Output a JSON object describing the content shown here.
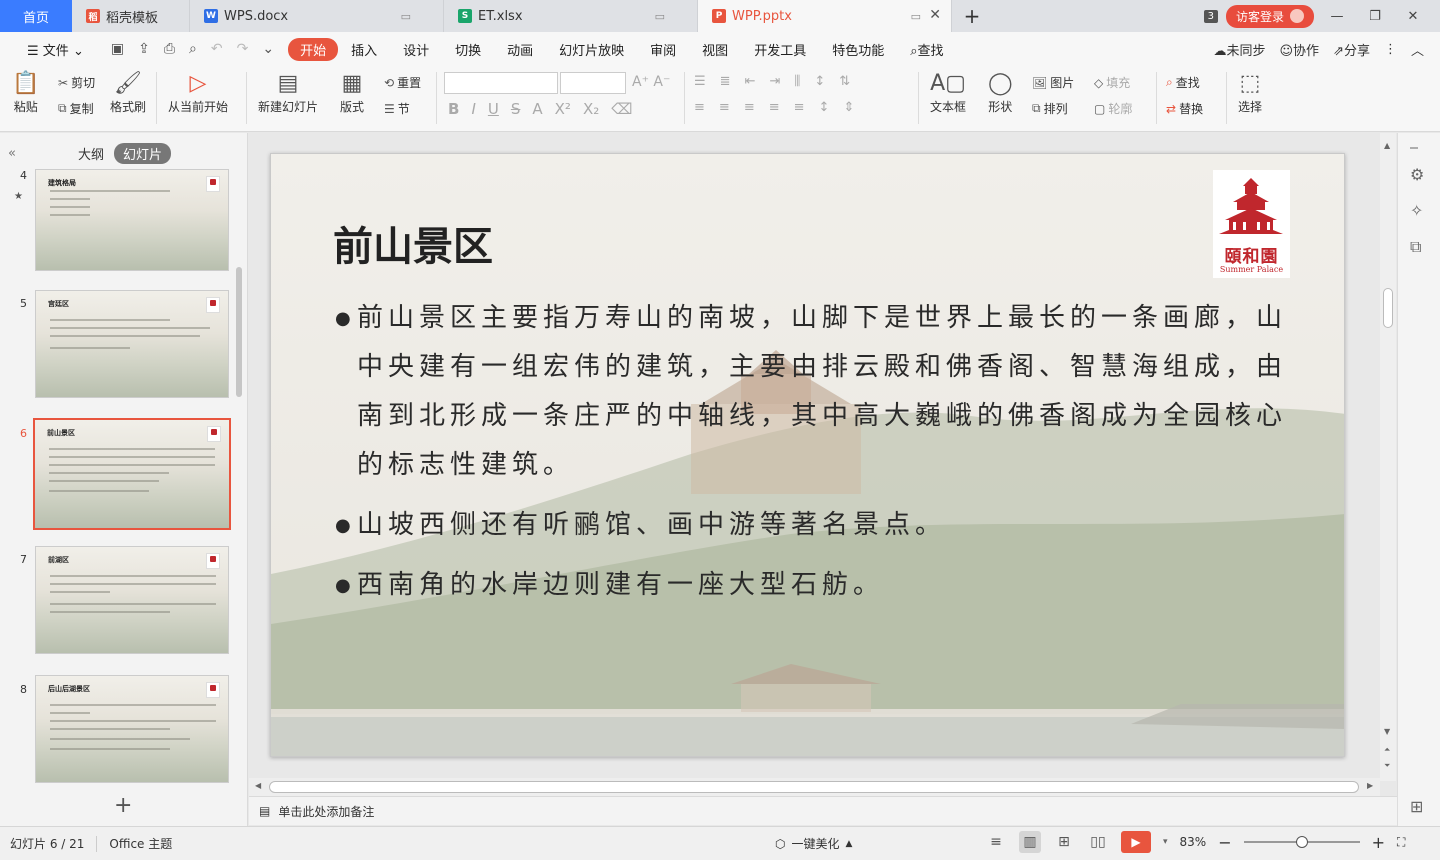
{
  "tabs": {
    "home": "首页",
    "items": [
      {
        "label": "稻壳模板",
        "icon": "daoke-icon",
        "color": "#e8553e"
      },
      {
        "label": "WPS.docx",
        "icon": "wps-writer-icon",
        "color": "#2f6ee5"
      },
      {
        "label": "ET.xlsx",
        "icon": "wps-sheet-icon",
        "color": "#1aa56b"
      },
      {
        "label": "WPP.pptx",
        "icon": "wps-ppt-icon",
        "color": "#e8553e"
      }
    ],
    "count": "3",
    "login": "访客登录"
  },
  "menu": {
    "file": "文件",
    "items": [
      "开始",
      "插入",
      "设计",
      "切换",
      "动画",
      "幻灯片放映",
      "审阅",
      "视图",
      "开发工具",
      "特色功能"
    ],
    "active": "开始",
    "search": "查找",
    "sync": "未同步",
    "collab": "协作",
    "share": "分享"
  },
  "ribbon": {
    "paste": "粘贴",
    "cut": "剪切",
    "copy": "复制",
    "format_painter": "格式刷",
    "from_current": "从当前开始",
    "new_slide": "新建幻灯片",
    "layout": "版式",
    "reset": "重置",
    "section": "节",
    "textbox": "文本框",
    "shape": "形状",
    "arrange": "排列",
    "picture": "图片",
    "fill": "填充",
    "outline": "轮廓",
    "find": "查找",
    "replace": "替换",
    "select": "选择"
  },
  "leftpanel": {
    "outline_tab": "大纲",
    "slides_tab": "幻灯片",
    "thumbs": [
      {
        "num": "4",
        "title": "建筑格局"
      },
      {
        "num": "5",
        "title": "宫廷区"
      },
      {
        "num": "6",
        "title": "前山景区"
      },
      {
        "num": "7",
        "title": "前湖区"
      },
      {
        "num": "8",
        "title": "后山后湖景区"
      }
    ],
    "selected": "6"
  },
  "slide": {
    "title": "前山景区",
    "bullets": [
      "前山景区主要指万寿山的南坡，山脚下是世界上最长的一条画廊，山中央建有一组宏伟的建筑，主要由排云殿和佛香阁、智慧海组成，由南到北形成一条庄严的中轴线，其中高大巍峨的佛香阁成为全园核心的标志性建筑。",
      "山坡西侧还有听鹂馆、画中游等著名景点。",
      "西南角的水岸边则建有一座大型石舫。"
    ],
    "logo_cn": "頤和園",
    "logo_en": "Summer Palace"
  },
  "notes": {
    "placeholder": "单击此处添加备注"
  },
  "status": {
    "slide_info": "幻灯片 6 / 21",
    "theme": "Office 主题",
    "beautify": "一键美化",
    "zoom": "83%"
  },
  "colors": {
    "accent": "#e8553e",
    "home_tab": "#3a7cff"
  }
}
